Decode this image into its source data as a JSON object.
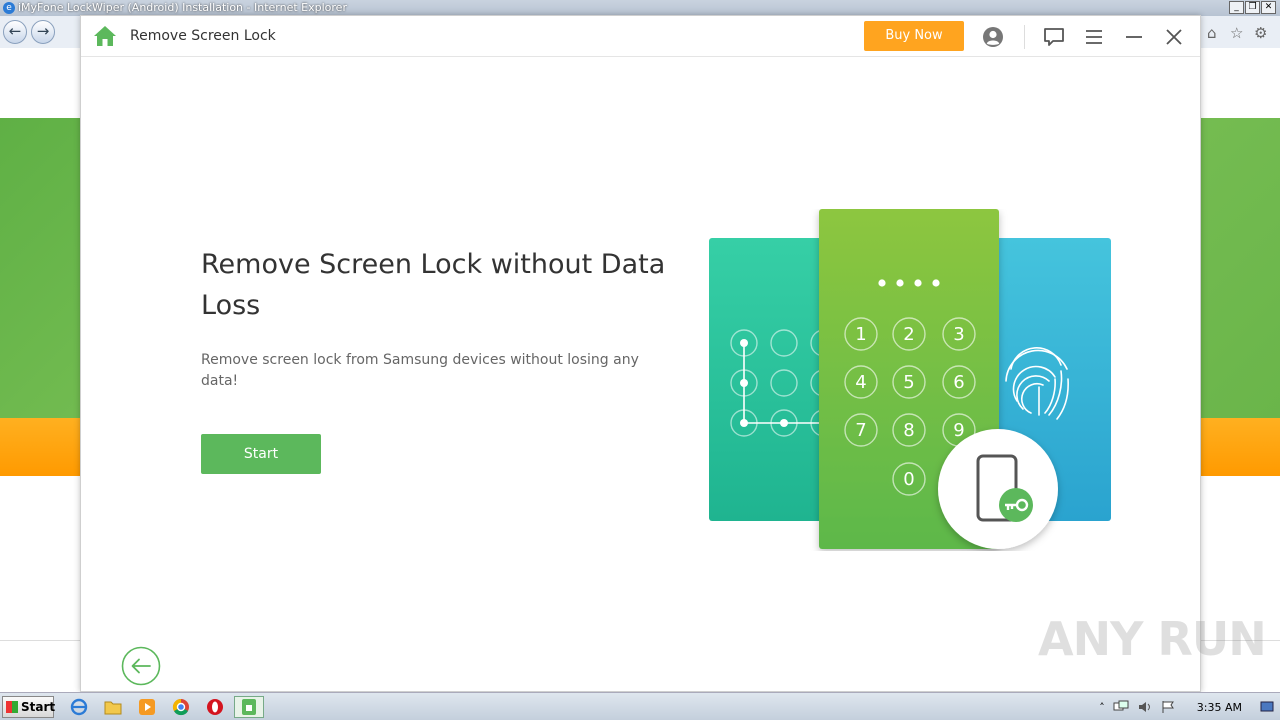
{
  "browser": {
    "title": "iMyFone LockWiper (Android) Installation - Internet Explorer",
    "controls": [
      "_",
      "❒",
      "✕"
    ]
  },
  "app": {
    "title": "Remove Screen Lock",
    "buy_label": "Buy Now",
    "headline": "Remove Screen Lock without Data Loss",
    "subline": "Remove screen lock from Samsung devices without losing any data!",
    "start_label": "Start",
    "keypad": [
      "1",
      "2",
      "3",
      "4",
      "5",
      "6",
      "7",
      "8",
      "9",
      "0"
    ],
    "accent": "#5cb85c",
    "buy_color": "#ffa41f"
  },
  "taskbar": {
    "start_label": "Start",
    "clock": "3:35 AM"
  },
  "watermark": "ANY RUN"
}
